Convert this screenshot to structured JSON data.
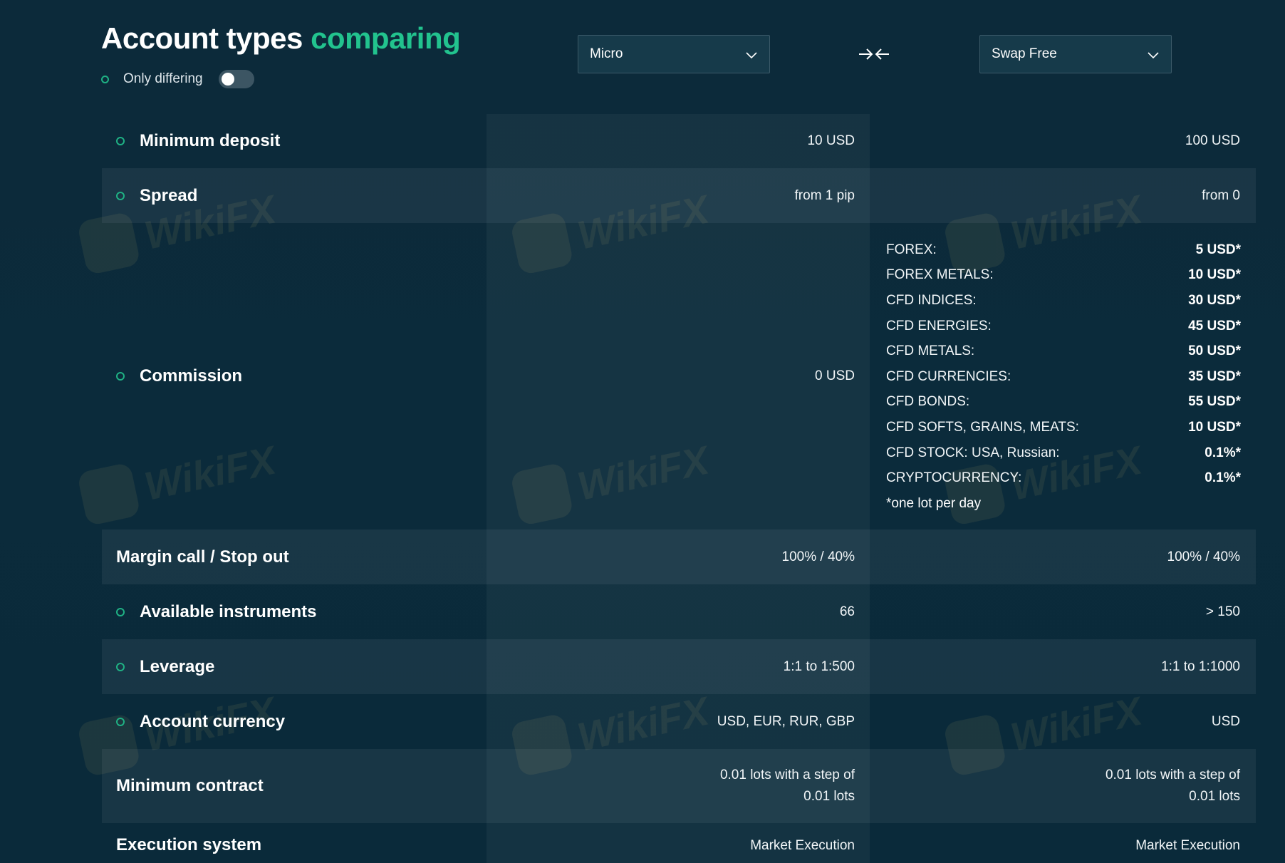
{
  "header": {
    "title_main": "Account types",
    "title_accent": "comparing",
    "only_differing_label": "Only differing",
    "left_select": "Micro",
    "right_select": "Swap Free"
  },
  "rows": {
    "min_deposit": {
      "name": "Minimum deposit",
      "a": "10 USD",
      "b": "100 USD"
    },
    "spread": {
      "name": "Spread",
      "a": "from 1 pip",
      "b": "from 0"
    },
    "commission": {
      "name": "Commission",
      "a": "0 USD"
    },
    "margin": {
      "name": "Margin call / Stop out",
      "a": "100% / 40%",
      "b": "100% / 40%"
    },
    "instruments": {
      "name": "Available instruments",
      "a": "66",
      "b": "> 150"
    },
    "leverage": {
      "name": "Leverage",
      "a": "1:1 to 1:500",
      "b": "1:1 to 1:1000"
    },
    "currency": {
      "name": "Account currency",
      "a": "USD, EUR, RUR, GBP",
      "b": "USD"
    },
    "min_contract": {
      "name": "Minimum contract",
      "a": "0.01 lots with a step of 0.01 lots",
      "b": "0.01 lots with a step of 0.01 lots"
    },
    "execution": {
      "name": "Execution system",
      "a": "Market Execution",
      "b": "Market Execution"
    }
  },
  "commission_list": [
    {
      "k": "FOREX:",
      "v": "5 USD*"
    },
    {
      "k": "FOREX METALS:",
      "v": "10 USD*"
    },
    {
      "k": "CFD INDICES:",
      "v": "30 USD*"
    },
    {
      "k": "CFD ENERGIES:",
      "v": "45 USD*"
    },
    {
      "k": "CFD METALS:",
      "v": "50 USD*"
    },
    {
      "k": "CFD CURRENCIES:",
      "v": "35 USD*"
    },
    {
      "k": "CFD BONDS:",
      "v": "55 USD*"
    },
    {
      "k": "CFD SOFTS, GRAINS, MEATS:",
      "v": "10 USD*"
    },
    {
      "k": "CFD STOCK: USA, Russian:",
      "v": "0.1%*"
    },
    {
      "k": "CRYPTOCURRENCY:",
      "v": "0.1%*"
    }
  ],
  "commission_note": "*one lot per day",
  "watermark": "WikiFX",
  "colors": {
    "accent": "#22c38e",
    "background": "#0b2a3a"
  },
  "icons": {
    "chevron": "chevron-down-icon",
    "swap": "swap-arrows-icon",
    "dot": "circle-outline-icon"
  }
}
